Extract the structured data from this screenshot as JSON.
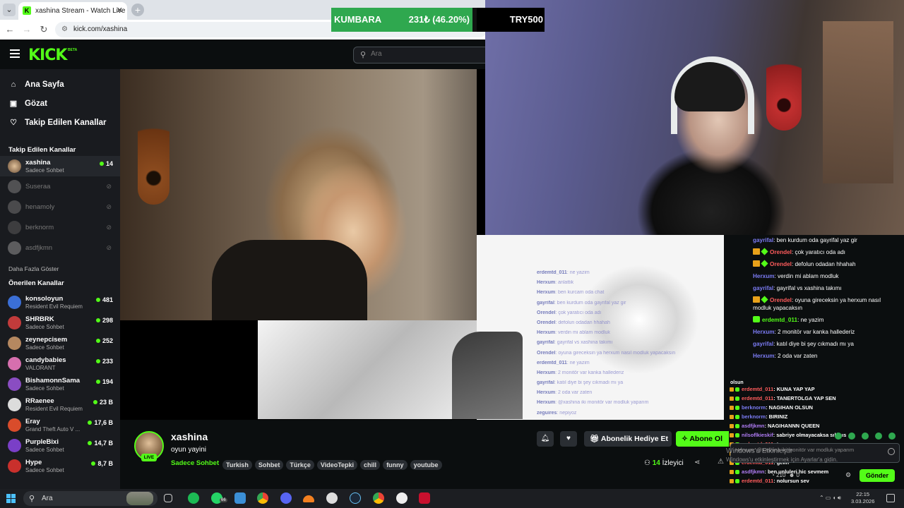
{
  "browser": {
    "tab_title": "xashina Stream - Watch Live",
    "url": "kick.com/xashina"
  },
  "overlay": {
    "label": "KUMBARA",
    "amount_percent": "231₺ (46.20%)",
    "progress": 0.462,
    "goal": "TRY500"
  },
  "header": {
    "logo": "KICK",
    "logo_badge": "BETA",
    "search_placeholder": "Ara"
  },
  "sidebar": {
    "nav": [
      {
        "label": "Ana Sayfa",
        "icon": "home-icon"
      },
      {
        "label": "Gözat",
        "icon": "browse-icon"
      },
      {
        "label": "Takip Edilen Kanallar",
        "icon": "heart-icon"
      }
    ],
    "followed_title": "Takip Edilen Kanallar",
    "followed": [
      {
        "name": "xashina",
        "category": "Sadece Sohbet",
        "viewers": "14",
        "live": true
      },
      {
        "name": "Suseraa",
        "live": false
      },
      {
        "name": "henamoly",
        "live": false
      },
      {
        "name": "berknorm",
        "live": false
      },
      {
        "name": "asdfjkmn",
        "live": false
      }
    ],
    "show_more": "Daha Fazla Göster",
    "recommended_title": "Önerilen Kanallar",
    "recommended": [
      {
        "name": "konsoloyun",
        "category": "Resident Evil Requiem",
        "viewers": "481"
      },
      {
        "name": "SHRBRK",
        "category": "Sadece Sohbet",
        "viewers": "298"
      },
      {
        "name": "zeynepcisem",
        "category": "Sadece Sohbet",
        "viewers": "252"
      },
      {
        "name": "candybabies",
        "category": "VALORANT",
        "viewers": "233"
      },
      {
        "name": "BishamonnSama",
        "category": "Sadece Sohbet",
        "viewers": "194"
      },
      {
        "name": "RRaenee",
        "category": "Resident Evil Requiem",
        "viewers": "23 B"
      },
      {
        "name": "Eray",
        "category": "Grand Theft Auto V ...",
        "viewers": "17,6 B"
      },
      {
        "name": "PurpleBixi",
        "category": "Sadece Sohbet",
        "viewers": "14,7 B"
      },
      {
        "name": "Hype",
        "category": "Sadece Sohbet",
        "viewers": "8,7 B"
      }
    ]
  },
  "mirror_chat": [
    {
      "u": "erdemtd_011",
      "t": "ne yazim"
    },
    {
      "u": "Herxum",
      "t": "anlattik"
    },
    {
      "u": "Herxum",
      "t": "ben kurcam oda chat"
    },
    {
      "u": "gayrifal",
      "t": "ben kurdum oda gayrifal yaz gir"
    },
    {
      "u": "Orendel",
      "t": "çok yaratıcı oda adı"
    },
    {
      "u": "Orendel",
      "t": "defolun odadan hhahah"
    },
    {
      "u": "Herxum",
      "t": "verdin mi ablam modluk"
    },
    {
      "u": "gayrifal",
      "t": "gayrifal vs xashina takımı"
    },
    {
      "u": "Orendel",
      "t": "oyuna gireceksin ya herxum nasıl modluk yapacaksın"
    },
    {
      "u": "erdemtd_011",
      "t": "ne yazim"
    },
    {
      "u": "Herxum",
      "t": "2 monitör var kanka hallederiz"
    },
    {
      "u": "gayrifal",
      "t": "katıl diye bi şey cıkmadı mı ya"
    },
    {
      "u": "Herxum",
      "t": "2 oda var zaten"
    },
    {
      "u": "Herxum",
      "t": "@xashina iki monitör var modluk yaparım"
    },
    {
      "u": "zeguires",
      "t": "nepiyoz"
    }
  ],
  "stream": {
    "streamer": "xashina",
    "live_label": "LIVE",
    "title": "oyun yayini",
    "category": "Sadece Sohbet",
    "tags": [
      "Turkish",
      "Sohbet",
      "Türkçe",
      "VideoTepki",
      "chill",
      "funny",
      "youtube"
    ],
    "gift_label": "Abonelik Hediye Et",
    "subscribe_label": "Abone Ol",
    "viewers_count": "14",
    "viewers_label": "İzleyici"
  },
  "chat": {
    "messages": [
      {
        "u": "gayrifal",
        "t": ": ben kurdum oda gayrifal yaz gir",
        "ucolor": "#7c7cf5",
        "badges": ""
      },
      {
        "u": "Orendel",
        "t": ": çok yaratıcı oda adı",
        "ucolor": "#ff5c5c",
        "badges": "cg"
      },
      {
        "u": "Orendel",
        "t": ": defolun odadan hhahah",
        "ucolor": "#ff5c5c",
        "badges": "cg"
      },
      {
        "u": "Herxum",
        "t": ": verdin mi ablam modluk",
        "ucolor": "#7c7cf5",
        "badges": ""
      },
      {
        "u": "gayrifal",
        "t": ": gayrifal vs xashina takımı",
        "ucolor": "#7c7cf5",
        "badges": ""
      },
      {
        "u": "Orendel",
        "t": ": oyuna gireceksin ya herxum nasıl modluk yapacaksın",
        "ucolor": "#ff5c5c",
        "badges": "cg"
      },
      {
        "u": "erdemtd_011",
        "t": ": ne yazim",
        "ucolor": "#53fc18",
        "badges": "s"
      },
      {
        "u": "Herxum",
        "t": ": 2 monitör var kanka hallederiz",
        "ucolor": "#7c7cf5",
        "badges": ""
      },
      {
        "u": "gayrifal",
        "t": ": katıl diye bi şey cıkmadı mı ya",
        "ucolor": "#7c7cf5",
        "badges": ""
      },
      {
        "u": "Herxum",
        "t": ": 2 oda var zaten",
        "ucolor": "#7c7cf5",
        "badges": ""
      }
    ],
    "olsun": "olsun",
    "overlay_messages": [
      {
        "u": "erdemtd_011",
        "t": ": KUNA YAP YAP",
        "ucolor": "#ff5c5c"
      },
      {
        "u": "erdemtd_011",
        "t": ": TANERTOLGA YAP SEN",
        "ucolor": "#ff5c5c"
      },
      {
        "u": "berknorm",
        "t": ": NAGIHAN OLSUN",
        "ucolor": "#7c7cf5"
      },
      {
        "u": "berknorm",
        "t": ": BIRINIZ",
        "ucolor": "#7c7cf5"
      },
      {
        "u": "asdfjkmn",
        "t": ": NAGIHANNN QUEEN",
        "ucolor": "#b07cf5"
      },
      {
        "u": "nilsoflkieskif",
        "t": ": sabriye olmayacaksa sıkınıs",
        "ucolor": "#b07cf5"
      },
      {
        "u": "erdemtd_011",
        "t": ": tuna",
        "ucolor": "#ff5c5c"
      },
      {
        "u": "erdemtd_011",
        "t": ": sizi odaya davet ettim",
        "ucolor": "#ff5c5c"
      },
      {
        "u": "erdemtd_011",
        "t": ": gelin",
        "ucolor": "#ff5c5c"
      },
      {
        "u": "asdfjkmn",
        "t": ": ben unluleri hic sevmem",
        "ucolor": "#b07cf5"
      },
      {
        "u": "erdemtd_011",
        "t": ": nolursun sev",
        "ucolor": "#ff5c5c"
      }
    ],
    "input_placeholder": "Herxum: @xashina iki monitör var modluk yaparım",
    "meta": "210",
    "meta2": "0",
    "send_label": "Gönder"
  },
  "windows_activate": {
    "line1": "Windows'u Etkinleştir",
    "line2": "Windows'u etkinleştirmek için Ayarlar'a gidin."
  },
  "taskbar": {
    "search": "Ara",
    "whatsapp_badge": "66",
    "time": "22:15",
    "date": "3.03.2026"
  }
}
